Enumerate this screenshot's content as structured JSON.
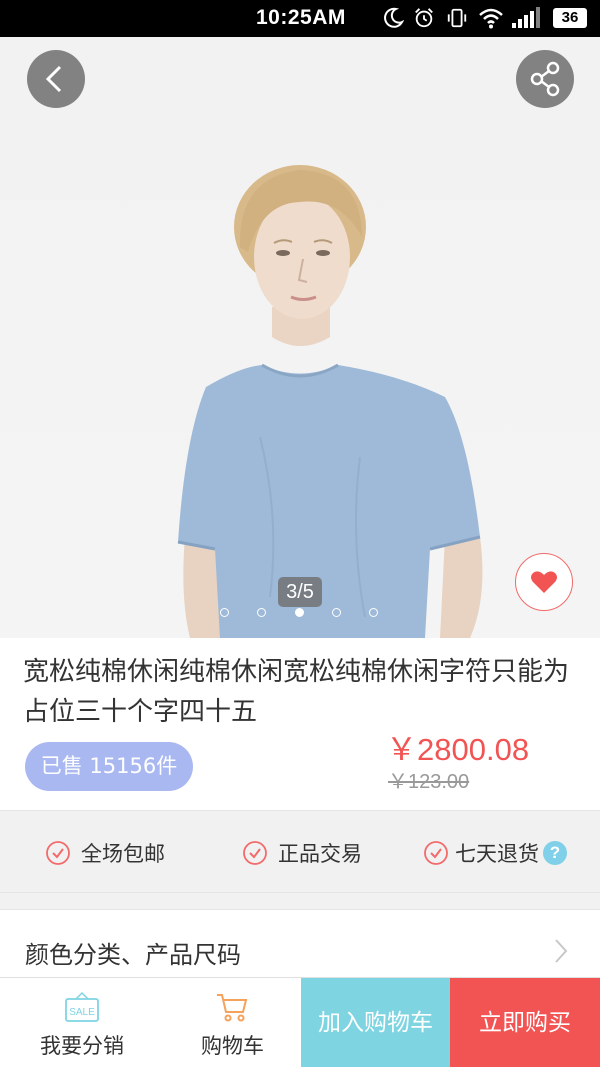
{
  "status_bar": {
    "time": "10:25AM",
    "battery": "36",
    "icons": [
      "moon-icon",
      "alarm-icon",
      "vibrate-icon",
      "wifi-icon",
      "signal-icon",
      "battery-icon"
    ]
  },
  "gallery": {
    "counter": "3/5",
    "total": 5,
    "current": 3
  },
  "product": {
    "title": "宽松纯棉休闲纯棉休闲宽松纯棉休闲字符只能为占位三十个字四十五",
    "sold": "已售 15156件",
    "price": "￥2800.08",
    "original_price": "￥123.00"
  },
  "services": [
    {
      "label": "全场包邮"
    },
    {
      "label": "正品交易"
    },
    {
      "label": "七天退货"
    }
  ],
  "options": {
    "label": "颜色分类、产品尺码"
  },
  "bottom_bar": {
    "distribute_label": "我要分销",
    "sale_text": "SALE",
    "cart_label": "购物车",
    "add_to_cart": "加入购物车",
    "buy_now": "立即购买"
  },
  "colors": {
    "accent_red": "#f25454",
    "accent_cyan": "#7fd4e2",
    "sold_badge": "#aab8f2",
    "icon_orange": "#f5a25c"
  }
}
